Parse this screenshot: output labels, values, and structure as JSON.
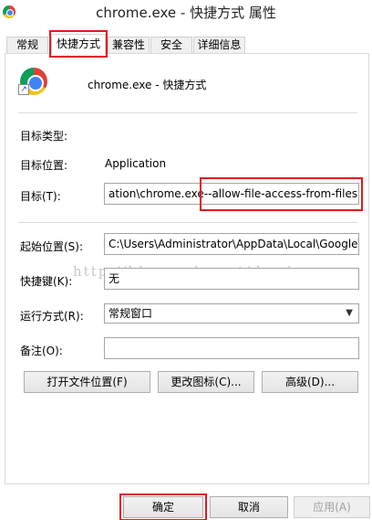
{
  "window": {
    "title": "chrome.exe - 快捷方式 属性"
  },
  "tabs": [
    "常规",
    "快捷方式",
    "兼容性",
    "安全",
    "详细信息"
  ],
  "header": {
    "name": "chrome.exe - 快捷方式"
  },
  "fields": {
    "target_type_label": "目标类型:",
    "target_location_label": "目标位置:",
    "target_location_value": "Application",
    "target_label": "目标(T):",
    "target_value_part1": "ation\\chrome.exe",
    "target_value_part2": "--allow-file-access-from-files",
    "start_in_label": "起始位置(S):",
    "start_in_value": "C:\\Users\\Administrator\\AppData\\Local\\Google\\",
    "shortcut_key_label": "快捷键(K):",
    "shortcut_key_value": "无",
    "run_label": "运行方式(R):",
    "run_value": "常规窗口",
    "comment_label": "备注(O):",
    "comment_value": ""
  },
  "buttons": {
    "open_location": "打开文件位置(F)",
    "change_icon": "更改图标(C)...",
    "advanced": "高级(D)...",
    "ok": "确定",
    "cancel": "取消",
    "apply": "应用(A)"
  },
  "watermark": "http://blog.csdn.net/dandanzmc",
  "colors": {
    "highlight": "#e0191f",
    "border": "#a5a5a5"
  }
}
